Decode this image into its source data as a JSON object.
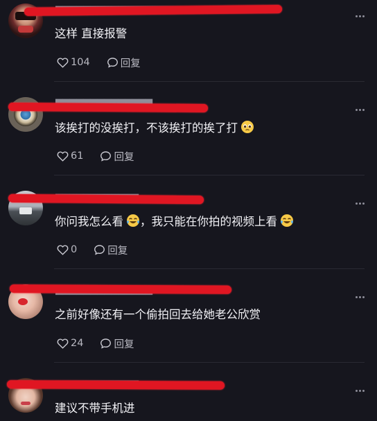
{
  "comments": [
    {
      "text": "这样 直接报警",
      "likes": "104",
      "reply_label": "回复"
    },
    {
      "text": "该挨打的没挨打，不该挨打的挨了打",
      "likes": "61",
      "reply_label": "回复"
    },
    {
      "text": "你问我怎么看",
      "text_mid": "，我只能在你拍的视频上看",
      "likes": "0",
      "reply_label": "回复"
    },
    {
      "text": "之前好像还有一个偷拍回去给她老公欣赏",
      "likes": "24",
      "reply_label": "回复"
    },
    {
      "text": "建议不带手机进"
    }
  ],
  "colors": {
    "background": "#16161e",
    "redaction": "#e01622",
    "text": "#f1f1f5",
    "muted": "#b9b9c2"
  },
  "icons": [
    "heart-icon",
    "comment-bubble-icon",
    "more-dots-icon",
    "pleading-face-emoji",
    "laughing-crying-emoji"
  ]
}
